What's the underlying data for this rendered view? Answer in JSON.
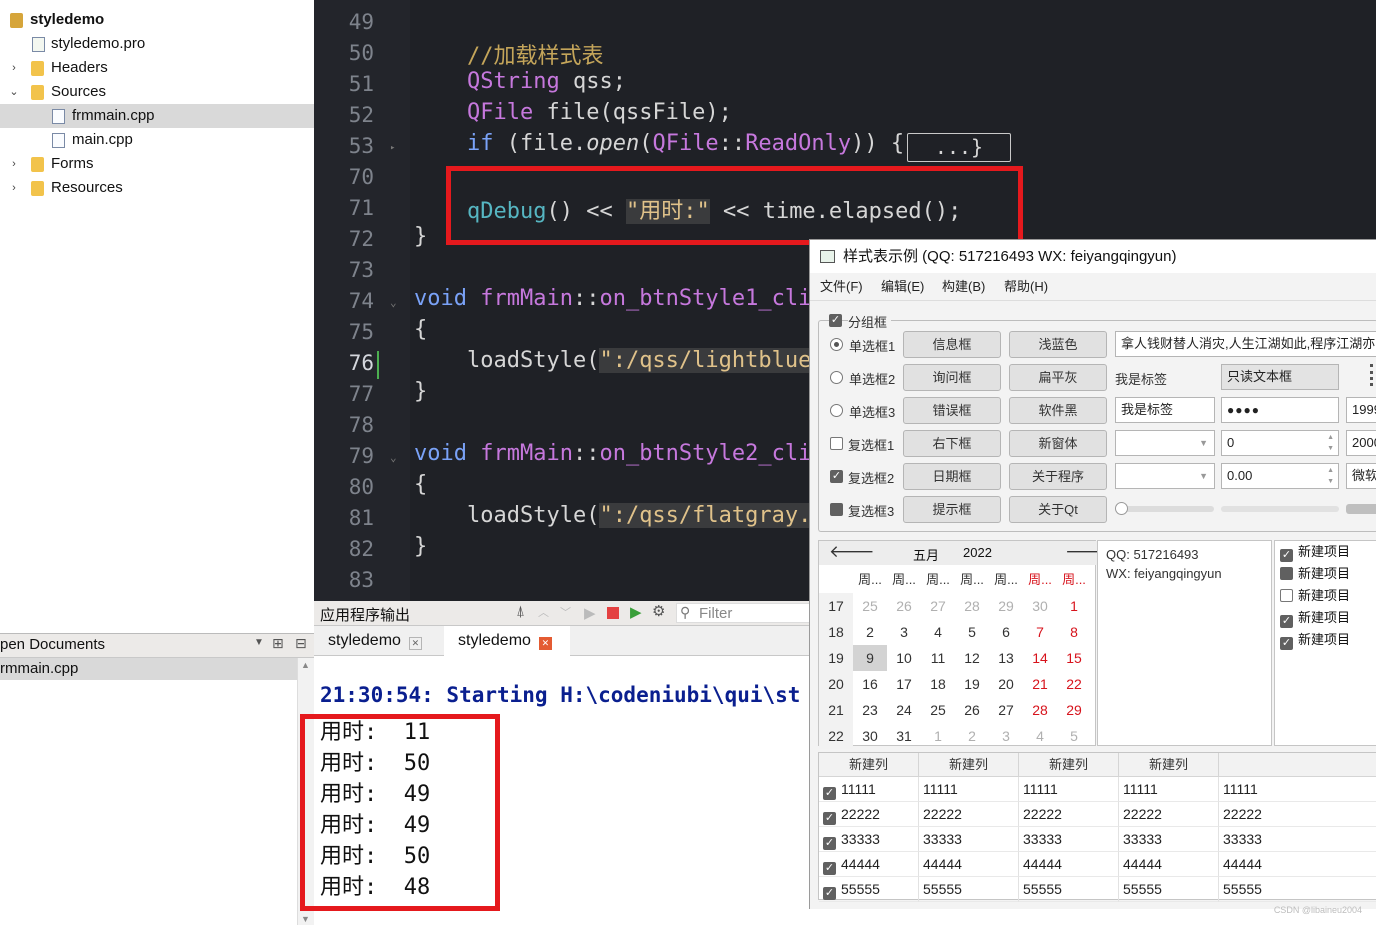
{
  "project_tree": {
    "root": "styledemo",
    "items": [
      {
        "label": "styledemo.pro",
        "icon": "pro-file-icon"
      },
      {
        "label": "Headers",
        "icon": "folder-icon",
        "expander": "›"
      },
      {
        "label": "Sources",
        "icon": "folder-icon",
        "expander": "⌄"
      },
      {
        "label": "frmmain.cpp",
        "icon": "cpp-file-icon",
        "selected": true
      },
      {
        "label": "main.cpp",
        "icon": "cpp-file-icon"
      },
      {
        "label": "Forms",
        "icon": "folder-icon",
        "expander": "›"
      },
      {
        "label": "Resources",
        "icon": "folder-icon",
        "expander": "›"
      }
    ]
  },
  "open_documents": {
    "title": "pen Documents",
    "items": [
      "rmmain.cpp"
    ]
  },
  "editor": {
    "line_numbers": [
      "49",
      "50",
      "51",
      "52",
      "53",
      "70",
      "71",
      "72",
      "73",
      "74",
      "75",
      "76",
      "77",
      "78",
      "79",
      "80",
      "81",
      "82",
      "83"
    ],
    "current_line": "76",
    "code": {
      "l50_comment": "//加载样式表",
      "l51_type": "QString",
      "l51_rest": " qss;",
      "l52_type": "QFile",
      "l52_rest": " file(qssFile);",
      "l53_if": "if",
      "l53_a": " (file.",
      "l53_open": "open",
      "l53_b": "(",
      "l53_cls": "QFile",
      "l53_sep": "::",
      "l53_enum": "ReadOnly",
      "l53_c": ")) {",
      "l53_fold": "...}",
      "l71_fn": "qDebug",
      "l71_a": "() << ",
      "l71_str": "\"用时:\"",
      "l71_b": " << time.elapsed();",
      "l72": "}",
      "l74_void": "void",
      "l74_cls": " frmMain",
      "l74_sep": "::",
      "l74_fn": "on_btnStyle1_cli",
      "l75": "{",
      "l76_a": "loadStyle(",
      "l76_str": "\":/qss/lightblue",
      "l77": "}",
      "l79_void": "void",
      "l79_cls": " frmMain",
      "l79_sep": "::",
      "l79_fn": "on_btnStyle2_cli",
      "l80": "{",
      "l81_a": "loadStyle(",
      "l81_str": "\":/qss/flatgray.",
      "l82": "}"
    }
  },
  "output": {
    "title": "应用程序输出",
    "filter_placeholder": "Filter",
    "tabs": [
      "styledemo",
      "styledemo"
    ],
    "starting_line": "21:30:54: Starting H:\\codeniubi\\qui\\st",
    "lines": [
      "用时:  11",
      "用时:  50",
      "用时:  49",
      "用时:  49",
      "用时:  50",
      "用时:  48"
    ]
  },
  "demo_window": {
    "title": "样式表示例 (QQ: 517216493 WX: feiyangqingyun)",
    "menu": [
      "文件(F)",
      "编辑(E)",
      "构建(B)",
      "帮助(H)"
    ],
    "group_title": "分组框",
    "radios": [
      "单选框1",
      "单选框2",
      "单选框3"
    ],
    "checkboxes": [
      "复选框1",
      "复选框2",
      "复选框3"
    ],
    "buttons_col1": [
      "信息框",
      "询问框",
      "错误框",
      "右下框",
      "日期框",
      "提示框"
    ],
    "buttons_col2": [
      "浅蓝色",
      "扁平灰",
      "软件黑",
      "新窗体",
      "关于程序",
      "关于Qt"
    ],
    "line_edit_text": "拿人钱财替人消灾,人生江湖如此,程序江湖亦",
    "label_text": "我是标签",
    "readonly_text": "只读文本框",
    "input_text": "我是标签",
    "password": "●●●●",
    "spin_int": "0",
    "spin_double": "0.00",
    "clip_right": [
      "1999",
      "2000",
      "微软"
    ],
    "calendar": {
      "month": "五月",
      "year": "2022",
      "weekdays": [
        "周...",
        "周...",
        "周...",
        "周...",
        "周...",
        "周...",
        "周..."
      ],
      "weeks": [
        "17",
        "18",
        "19",
        "20",
        "21",
        "22"
      ],
      "days": [
        [
          "25",
          "26",
          "27",
          "28",
          "29",
          "30",
          "1"
        ],
        [
          "2",
          "3",
          "4",
          "5",
          "6",
          "7",
          "8"
        ],
        [
          "9",
          "10",
          "11",
          "12",
          "13",
          "14",
          "15"
        ],
        [
          "16",
          "17",
          "18",
          "19",
          "20",
          "21",
          "22"
        ],
        [
          "23",
          "24",
          "25",
          "26",
          "27",
          "28",
          "29"
        ],
        [
          "30",
          "31",
          "1",
          "2",
          "3",
          "4",
          "5"
        ]
      ]
    },
    "info_lines": [
      "QQ:  517216493",
      "WX:  feiyangqingyun"
    ],
    "list_items": [
      "新建项目",
      "新建项目",
      "新建项目",
      "新建项目",
      "新建项目"
    ],
    "table_headers": [
      "新建列",
      "新建列",
      "新建列",
      "新建列"
    ],
    "table_rows": [
      [
        "11111",
        "11111",
        "11111",
        "11111",
        "11111"
      ],
      [
        "22222",
        "22222",
        "22222",
        "22222",
        "22222"
      ],
      [
        "33333",
        "33333",
        "33333",
        "33333",
        "33333"
      ],
      [
        "44444",
        "44444",
        "44444",
        "44444",
        "44444"
      ],
      [
        "55555",
        "55555",
        "55555",
        "55555",
        "55555"
      ]
    ]
  },
  "watermark": "CSDN @libaineu2004",
  "colors": {
    "highlight_box": "#e5191d",
    "editor_bg": "#1f2126",
    "weekend_red": "#d7131c"
  }
}
